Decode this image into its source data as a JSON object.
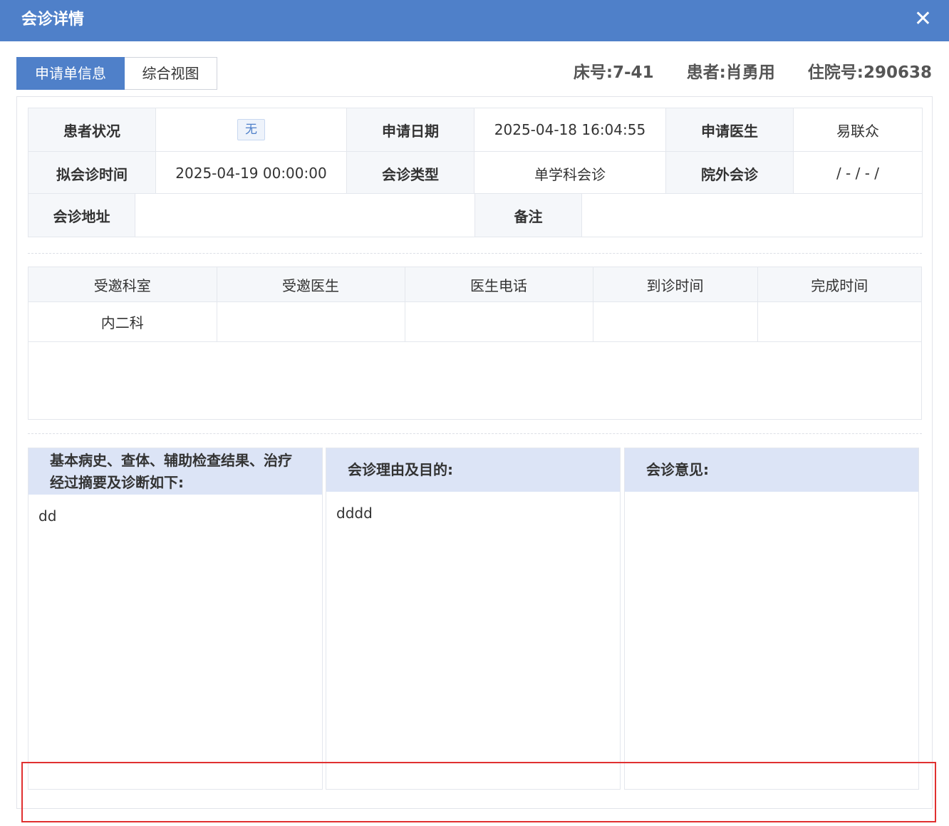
{
  "window": {
    "title": "会诊详情",
    "close_glyph": "✕"
  },
  "tabs": [
    {
      "label": "申请单信息",
      "active": true
    },
    {
      "label": "综合视图",
      "active": false
    }
  ],
  "patient": {
    "bed": "床号:7-41",
    "name": "患者:肖勇用",
    "admission": "住院号:290638"
  },
  "info": {
    "status_label": "患者状况",
    "status_value": "无",
    "apply_date_label": "申请日期",
    "apply_date_value": "2025-04-18 16:04:55",
    "apply_doctor_label": "申请医生",
    "apply_doctor_value": "易联众",
    "planned_time_label": "拟会诊时间",
    "planned_time_value": "2025-04-19 00:00:00",
    "type_label": "会诊类型",
    "type_value": "单学科会诊",
    "external_label": "院外会诊",
    "external_value": "/ - / - /",
    "address_label": "会诊地址",
    "address_value": "",
    "remark_label": "备注",
    "remark_value": ""
  },
  "invited": {
    "headers": [
      "受邀科室",
      "受邀医生",
      "医生电话",
      "到诊时间",
      "完成时间"
    ],
    "rows": [
      [
        "内二科",
        "",
        "",
        "",
        ""
      ]
    ]
  },
  "cards": [
    {
      "title": "基本病史、查体、辅助检查结果、治疗经过摘要及诊断如下:",
      "content": "dd"
    },
    {
      "title": "会诊理由及目的:",
      "content": "dddd"
    },
    {
      "title": "会诊意见:",
      "content": ""
    }
  ],
  "colors": {
    "header": "#4f80c9",
    "card_header": "#dce4f6",
    "label_bg": "#f5f7fa",
    "highlight": "#e03030"
  }
}
